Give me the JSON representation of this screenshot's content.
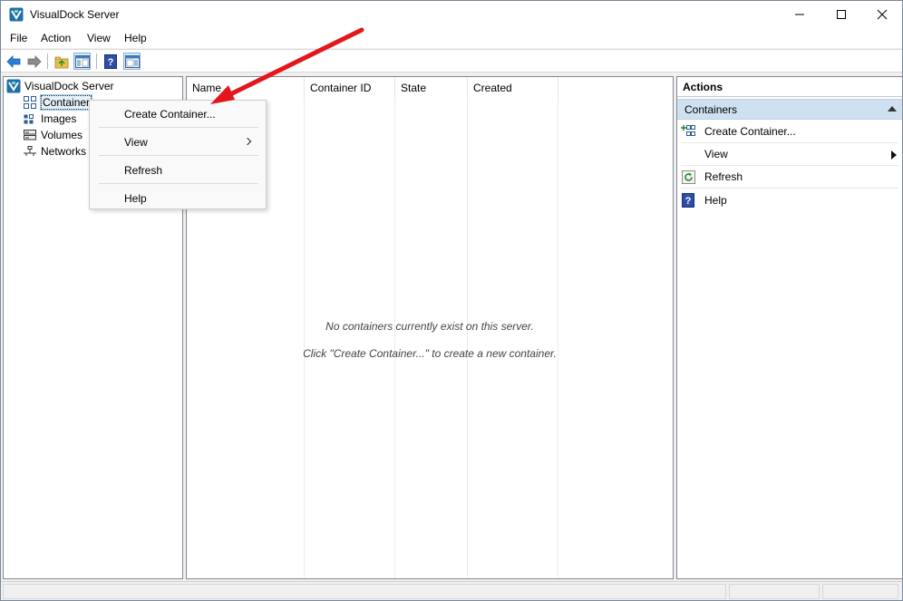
{
  "window": {
    "title": "VisualDock Server"
  },
  "menu": {
    "items": [
      "File",
      "Action",
      "View",
      "Help"
    ]
  },
  "toolbar": {
    "buttons": [
      "back-icon",
      "forward-icon",
      "folder-up-icon",
      "show-hide-tree-icon",
      "help-icon",
      "show-hide-action-pane-icon"
    ]
  },
  "tree": {
    "root": "VisualDock Server",
    "children": [
      "Container",
      "Images",
      "Volumes",
      "Networks"
    ]
  },
  "list": {
    "columns": [
      "Name",
      "Container ID",
      "State",
      "Created"
    ],
    "empty_line1": "No containers currently exist on this server.",
    "empty_line2": "Click \"Create Container...\" to create a new container."
  },
  "actions": {
    "header": "Actions",
    "section": "Containers",
    "items": [
      "Create Container...",
      "View",
      "Refresh",
      "Help"
    ]
  },
  "context_menu": {
    "items": [
      "Create Container...",
      "View",
      "Refresh",
      "Help"
    ]
  },
  "colors": {
    "accent": "#1e6cc8",
    "annotation_arrow": "#e3171b",
    "selection": "#e5f1fb"
  }
}
